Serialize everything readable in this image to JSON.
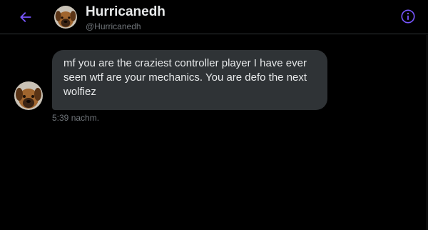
{
  "header": {
    "back_icon": "arrow-left-icon",
    "display_name": "Hurricanedh",
    "handle": "@Hurricanedh",
    "info_icon": "info-circle-icon",
    "accent_color": "#7856ff"
  },
  "conversation": {
    "messages": [
      {
        "text": "mf you are the craziest controller player I have ever seen wtf are your mechanics. You are defo the next wolfiez",
        "time": "5:39 nachm."
      }
    ]
  },
  "colors": {
    "background": "#000000",
    "bubble": "#2f3336",
    "text": "#e7e9ea",
    "muted": "#71767b"
  }
}
